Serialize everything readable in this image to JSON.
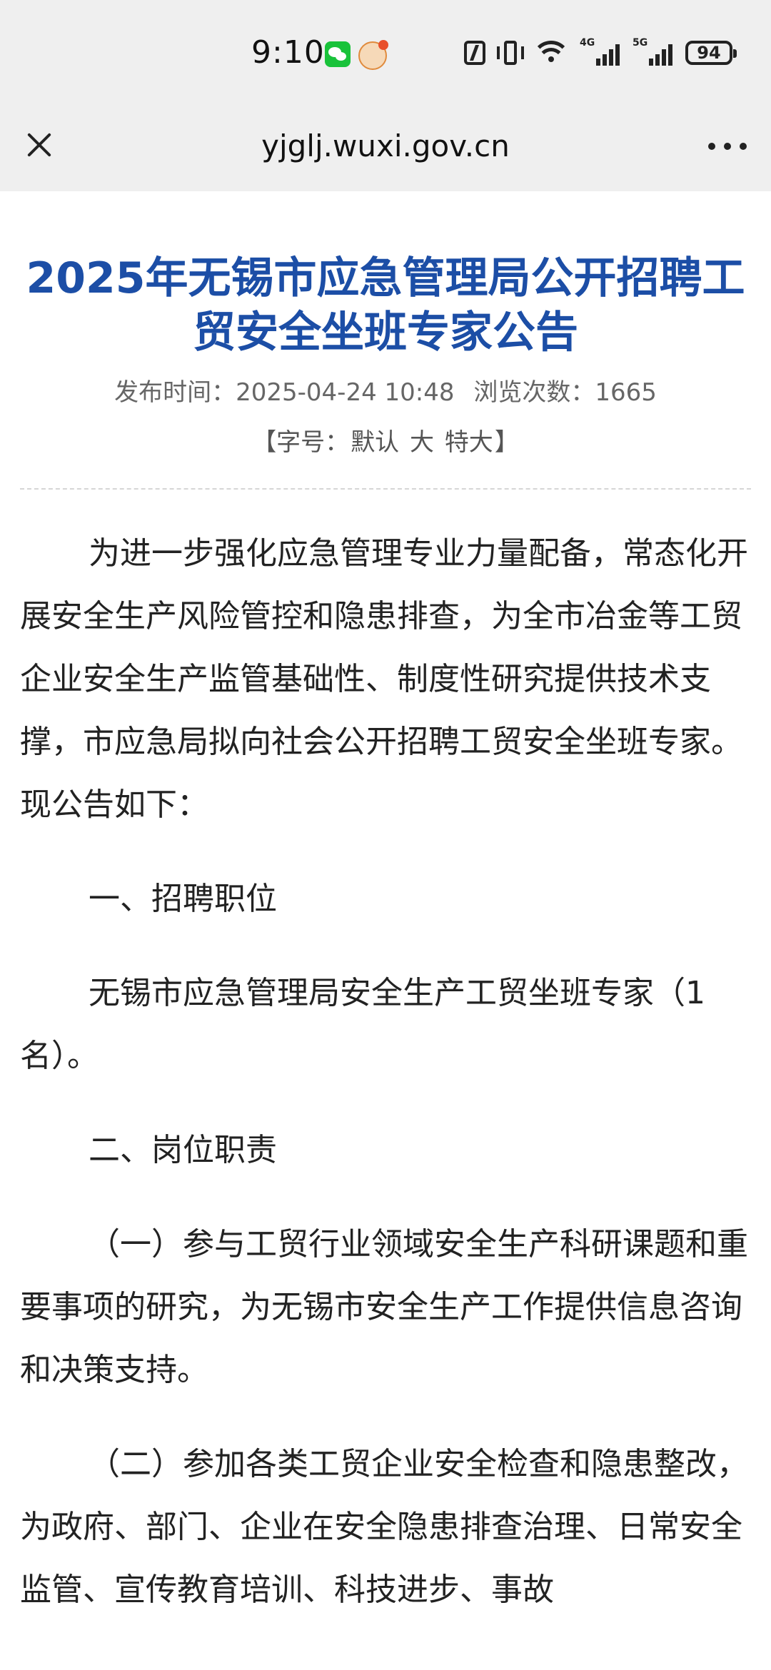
{
  "status_bar": {
    "time": "9:10",
    "icons": [
      "wechat-icon",
      "mascot-icon",
      "nfc-icon",
      "vibrate-icon",
      "wifi-icon",
      "4g-signal-icon",
      "5g-signal-icon",
      "battery-icon"
    ],
    "signal_4g_label": "4G",
    "signal_5g_label": "5G",
    "battery_level": "94"
  },
  "browser": {
    "url": "yjglj.wuxi.gov.cn",
    "close_icon": "close-icon",
    "more_icon": "more-icon"
  },
  "article": {
    "title": "2025年无锡市应急管理局公开招聘工贸安全坐班专家公告",
    "publish_label": "发布时间：",
    "publish_time": "2025-04-24 10:48",
    "views_label": "浏览次数：",
    "views": "1665",
    "font_size": {
      "open": "【字号：",
      "default": "默认",
      "large": "大",
      "xlarge": "特大",
      "close": "】"
    },
    "paragraphs": {
      "intro": "为进一步强化应急管理专业力量配备，常态化开展安全生产风险管控和隐患排查，为全市冶金等工贸企业安全生产监管基础性、制度性研究提供技术支撑，市应急局拟向社会公开招聘工贸安全坐班专家。现公告如下：",
      "section1": "一、招聘职位",
      "position": "无锡市应急管理局安全生产工贸坐班专家（1名）。",
      "section2": "二、岗位职责",
      "duty1": "（一）参与工贸行业领域安全生产科研课题和重要事项的研究，为无锡市安全生产工作提供信息咨询和决策支持。",
      "duty2": "（二）参加各类工贸企业安全检查和隐患整改，为政府、部门、企业在安全隐患排查治理、日常安全监管、宣传教育培训、科技进步、事故"
    }
  }
}
